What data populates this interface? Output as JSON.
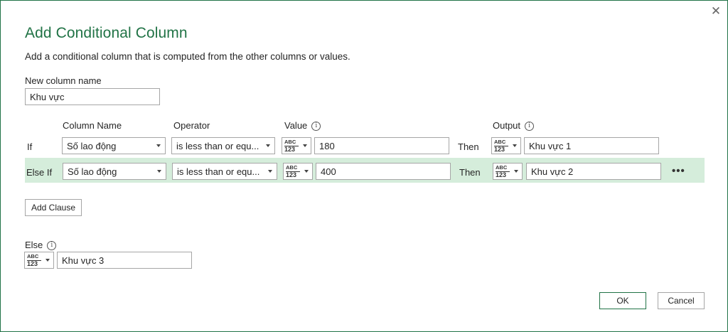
{
  "dialog": {
    "title": "Add Conditional Column",
    "description": "Add a conditional column that is computed from the other columns or values.",
    "close_symbol": "✕"
  },
  "new_column": {
    "label": "New column name",
    "value": "Khu vực"
  },
  "headers": {
    "column_name": "Column Name",
    "operator": "Operator",
    "value": "Value",
    "output": "Output"
  },
  "type_icon": {
    "line1": "ABC",
    "line2": "123"
  },
  "clauses": [
    {
      "keyword": "If",
      "column": "Số lao động",
      "operator": "is less than or equ...",
      "value": "180",
      "then": "Then",
      "output": "Khu vực 1"
    },
    {
      "keyword": "Else If",
      "column": "Số lao động",
      "operator": "is less than or equ...",
      "value": "400",
      "then": "Then",
      "output": "Khu vực 2"
    }
  ],
  "more_symbol": "•••",
  "add_clause_label": "Add Clause",
  "else": {
    "label": "Else",
    "value": "Khu vực 3"
  },
  "info_symbol": "i",
  "buttons": {
    "ok": "OK",
    "cancel": "Cancel"
  },
  "colors": {
    "accent": "#217346",
    "highlight": "#d5eddb"
  }
}
